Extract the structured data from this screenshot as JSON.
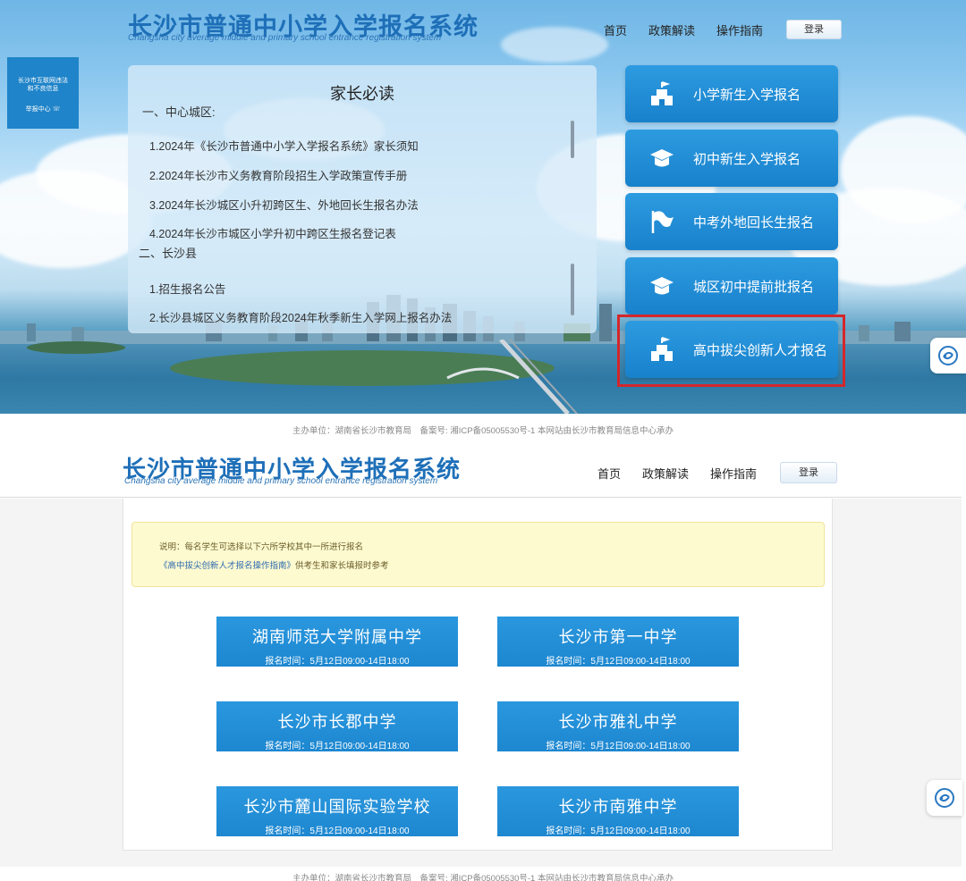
{
  "top": {
    "title": "长沙市普通中小学入学报名系统",
    "subtitle": "Changsha city average middle and primary school entrance registration system",
    "nav": [
      "首页",
      "政策解读",
      "操作指南"
    ],
    "login_label": "登录",
    "side_badge": {
      "line1": "长沙市互联网违法",
      "line2": "和不良信息",
      "line3": "举报中心 ☏"
    },
    "notice": {
      "title": "家长必读",
      "section1": "一、中心城区:",
      "items1": [
        "1.2024年《长沙市普通中小学入学报名系统》家长须知",
        "2.2024年长沙市义务教育阶段招生入学政策宣传手册",
        "3.2024年长沙城区小升初跨区生、外地回长生报名办法",
        "4.2024年长沙市城区小学升初中跨区生报名登记表"
      ],
      "section2": "二、长沙县",
      "items2": [
        "1.招生报名公告",
        "2.长沙县城区义务教育阶段2024年秋季新生入学网上报名办法"
      ]
    },
    "menu": [
      {
        "label": "小学新生入学报名",
        "icon": "school-building-icon"
      },
      {
        "label": "初中新生入学报名",
        "icon": "graduation-cap-icon"
      },
      {
        "label": "中考外地回长生报名",
        "icon": "flag-icon"
      },
      {
        "label": "城区初中提前批报名",
        "icon": "graduation-cap-icon"
      },
      {
        "label": "高中拔尖创新人才报名",
        "icon": "school-building-icon"
      }
    ],
    "highlight_color": "#d4272b"
  },
  "footer": "主办单位：湖南省长沙市教育局　备案号: 湘ICP备05005530号-1 本网站由长沙市教育局信息中心承办",
  "bottom": {
    "title": "长沙市普通中小学入学报名系统",
    "subtitle": "Changsha city average middle and primary school entrance registration system",
    "nav": [
      "首页",
      "政策解读",
      "操作指南"
    ],
    "login_label": "登录",
    "tip": {
      "line1": "说明：每名学生可选择以下六所学校其中一所进行报名",
      "link": "《高中拔尖创新人才报名操作指南》",
      "line2_rest": "供考生和家长填报时参考"
    },
    "schools": [
      {
        "name": "湖南师范大学附属中学",
        "time": "报名时间：5月12日09:00-14日18:00"
      },
      {
        "name": "长沙市第一中学",
        "time": "报名时间：5月12日09:00-14日18:00"
      },
      {
        "name": "长沙市长郡中学",
        "time": "报名时间：5月12日09:00-14日18:00"
      },
      {
        "name": "长沙市雅礼中学",
        "time": "报名时间：5月12日09:00-14日18:00"
      },
      {
        "name": "长沙市麓山国际实验学校",
        "time": "报名时间：5月12日09:00-14日18:00"
      },
      {
        "name": "长沙市南雅中学",
        "time": "报名时间：5月12日09:00-14日18:00"
      }
    ]
  },
  "colors": {
    "brand_blue": "#1e6fb8",
    "button_blue": "#1d87d0",
    "tip_bg": "#fefad0"
  }
}
